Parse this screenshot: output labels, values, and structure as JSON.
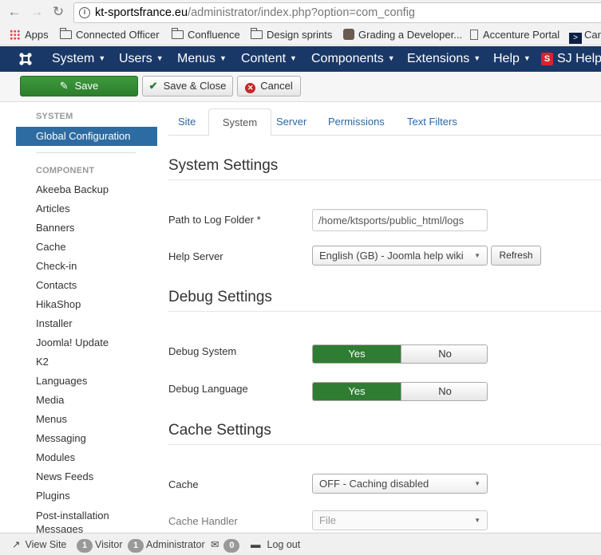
{
  "browser": {
    "url_host": "kt-sportsfrance.eu",
    "url_path": "/administrator/index.php?option=com_config",
    "bookmarks": [
      {
        "icon": "apps-icon",
        "label": "Apps"
      },
      {
        "icon": "folder-icon",
        "label": "Connected Officer"
      },
      {
        "icon": "folder-icon",
        "label": "Confluence"
      },
      {
        "icon": "folder-icon",
        "label": "Design sprints"
      },
      {
        "icon": "avatar-icon",
        "label": "Grading a Developer..."
      },
      {
        "icon": "page-icon",
        "label": "Accenture Portal"
      },
      {
        "icon": "jira-icon",
        "label": "Car"
      }
    ]
  },
  "nav": {
    "menus": [
      "System",
      "Users",
      "Menus",
      "Content",
      "Components",
      "Extensions",
      "Help"
    ],
    "sj_help": "SJ Help"
  },
  "toolbar": {
    "save": "Save",
    "save_close": "Save & Close",
    "cancel": "Cancel"
  },
  "sidebar": {
    "system_heading": "SYSTEM",
    "active_item": "Global Configuration",
    "component_heading": "COMPONENT",
    "items": [
      "Akeeba Backup",
      "Articles",
      "Banners",
      "Cache",
      "Check-in",
      "Contacts",
      "HikaShop",
      "Installer",
      "Joomla! Update",
      "K2",
      "Languages",
      "Media",
      "Menus",
      "Messaging",
      "Modules",
      "News Feeds",
      "Plugins",
      "Post-installation Messages"
    ]
  },
  "tabs": [
    "Site",
    "System",
    "Server",
    "Permissions",
    "Text Filters"
  ],
  "active_tab": "System",
  "system_settings": {
    "title": "System Settings",
    "log_folder_label": "Path to Log Folder *",
    "log_folder_value": "/home/ktsports/public_html/logs",
    "help_server_label": "Help Server",
    "help_server_value": "English (GB) - Joomla help wiki",
    "refresh_label": "Refresh"
  },
  "debug_settings": {
    "title": "Debug Settings",
    "debug_system_label": "Debug System",
    "debug_language_label": "Debug Language",
    "yes": "Yes",
    "no": "No"
  },
  "cache_settings": {
    "title": "Cache Settings",
    "cache_label": "Cache",
    "cache_value": "OFF - Caching disabled",
    "handler_label": "Cache Handler",
    "handler_value": "File"
  },
  "statusbar": {
    "view_site": "View Site",
    "visitor_count": "1",
    "visitor_label": "Visitor",
    "admin_count": "1",
    "admin_label": "Administrator",
    "messages_count": "0",
    "logout": "Log out"
  }
}
